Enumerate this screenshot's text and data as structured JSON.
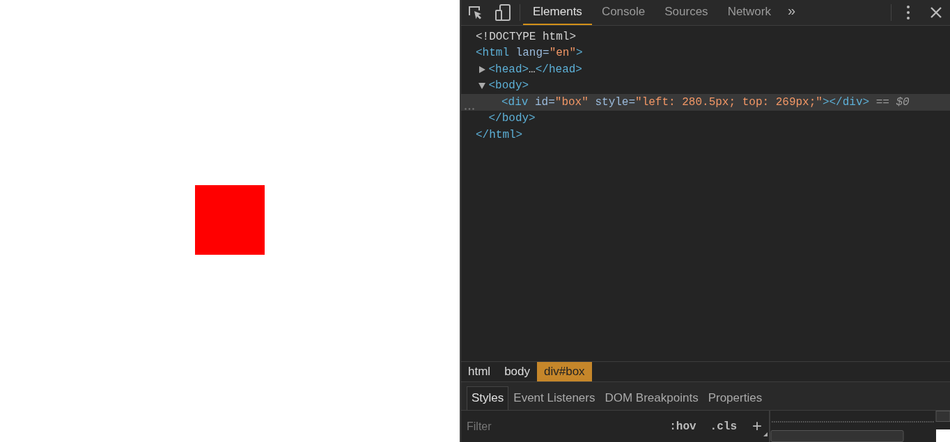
{
  "toolbar": {
    "tabs": [
      {
        "label": "Elements",
        "selected": true
      },
      {
        "label": "Console",
        "selected": false
      },
      {
        "label": "Sources",
        "selected": false
      },
      {
        "label": "Network",
        "selected": false
      }
    ],
    "more": "»"
  },
  "dom_tree": [
    {
      "selected": false,
      "tokens": [
        {
          "kind": "plain",
          "text": "<!DOCTYPE html>"
        }
      ]
    },
    {
      "selected": false,
      "tokens": [
        {
          "kind": "tag",
          "text": "<html"
        },
        {
          "kind": "attr",
          "text": " lang="
        },
        {
          "kind": "value",
          "text": "\"en\""
        },
        {
          "kind": "tag",
          "text": ">"
        }
      ],
      "children": [
        {
          "expanded": false,
          "selected": false,
          "tokens": [
            {
              "kind": "tag",
              "text": "<head>"
            },
            {
              "kind": "plain",
              "text": "…"
            },
            {
              "kind": "tag",
              "text": "</head>"
            }
          ]
        },
        {
          "expanded": true,
          "selected": false,
          "tokens": [
            {
              "kind": "tag",
              "text": "<body>"
            }
          ],
          "children": [
            {
              "selected": true,
              "tokens": [
                {
                  "kind": "tag",
                  "text": "<div"
                },
                {
                  "kind": "attr",
                  "text": " id="
                },
                {
                  "kind": "value",
                  "text": "\"box\""
                },
                {
                  "kind": "attr",
                  "text": " style="
                },
                {
                  "kind": "value",
                  "text": "\"left: 280.5px; top: 269px;\""
                },
                {
                  "kind": "tag",
                  "text": "></div>"
                },
                {
                  "kind": "hint",
                  "text": " == "
                },
                {
                  "kind": "hintvar",
                  "text": "$0"
                }
              ]
            }
          ],
          "close": [
            {
              "kind": "tag",
              "text": "</body>"
            }
          ]
        }
      ],
      "close": [
        {
          "kind": "tag",
          "text": "</html>"
        }
      ]
    }
  ],
  "breadcrumbs": [
    {
      "label": "html",
      "selected": false
    },
    {
      "label": "body",
      "selected": false
    },
    {
      "label": "div#box",
      "selected": true
    }
  ],
  "sidebar_tabs": [
    {
      "label": "Styles",
      "selected": true
    },
    {
      "label": "Event Listeners",
      "selected": false
    },
    {
      "label": "DOM Breakpoints",
      "selected": false
    },
    {
      "label": "Properties",
      "selected": false
    }
  ],
  "filter": {
    "placeholder": "Filter"
  },
  "filter_buttons": [
    ":hov",
    ".cls",
    "+"
  ]
}
